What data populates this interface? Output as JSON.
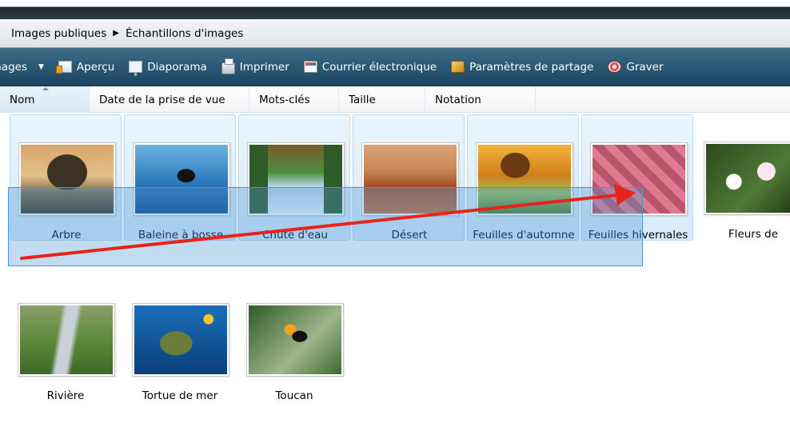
{
  "breadcrumb": {
    "items": [
      "Images publiques",
      "Échantillons d'images"
    ],
    "separator": "▶"
  },
  "toolbar": {
    "items": [
      {
        "label": "Images",
        "icon": "images-menu"
      },
      {
        "label": "Aperçu",
        "icon": "preview-icon"
      },
      {
        "label": "Diaporama",
        "icon": "slideshow-icon"
      },
      {
        "label": "Imprimer",
        "icon": "printer-icon"
      },
      {
        "label": "Courrier électronique",
        "icon": "email-icon"
      },
      {
        "label": "Paramètres de partage",
        "icon": "share-icon"
      },
      {
        "label": "Graver",
        "icon": "burn-disc-icon"
      }
    ]
  },
  "columns": [
    "Nom",
    "Date de la prise de vue",
    "Mots-clés",
    "Taille",
    "Notation"
  ],
  "files": [
    {
      "label": "Arbre",
      "selected": true
    },
    {
      "label": "Baleine à bosse",
      "selected": true
    },
    {
      "label": "Chute d'eau",
      "selected": true
    },
    {
      "label": "Désert",
      "selected": true
    },
    {
      "label": "Feuilles d'automne",
      "selected": true
    },
    {
      "label": "Feuilles hivernales",
      "selected": true
    },
    {
      "label": "Fleurs de frangipanier",
      "selected": false
    },
    {
      "label": "Rivière",
      "selected": false
    },
    {
      "label": "Tortue de mer",
      "selected": false
    },
    {
      "label": "Toucan",
      "selected": false
    }
  ],
  "colors": {
    "toolbar": "#2c5a76",
    "selection": "#4c93cf",
    "arrow": "#e8231b"
  }
}
